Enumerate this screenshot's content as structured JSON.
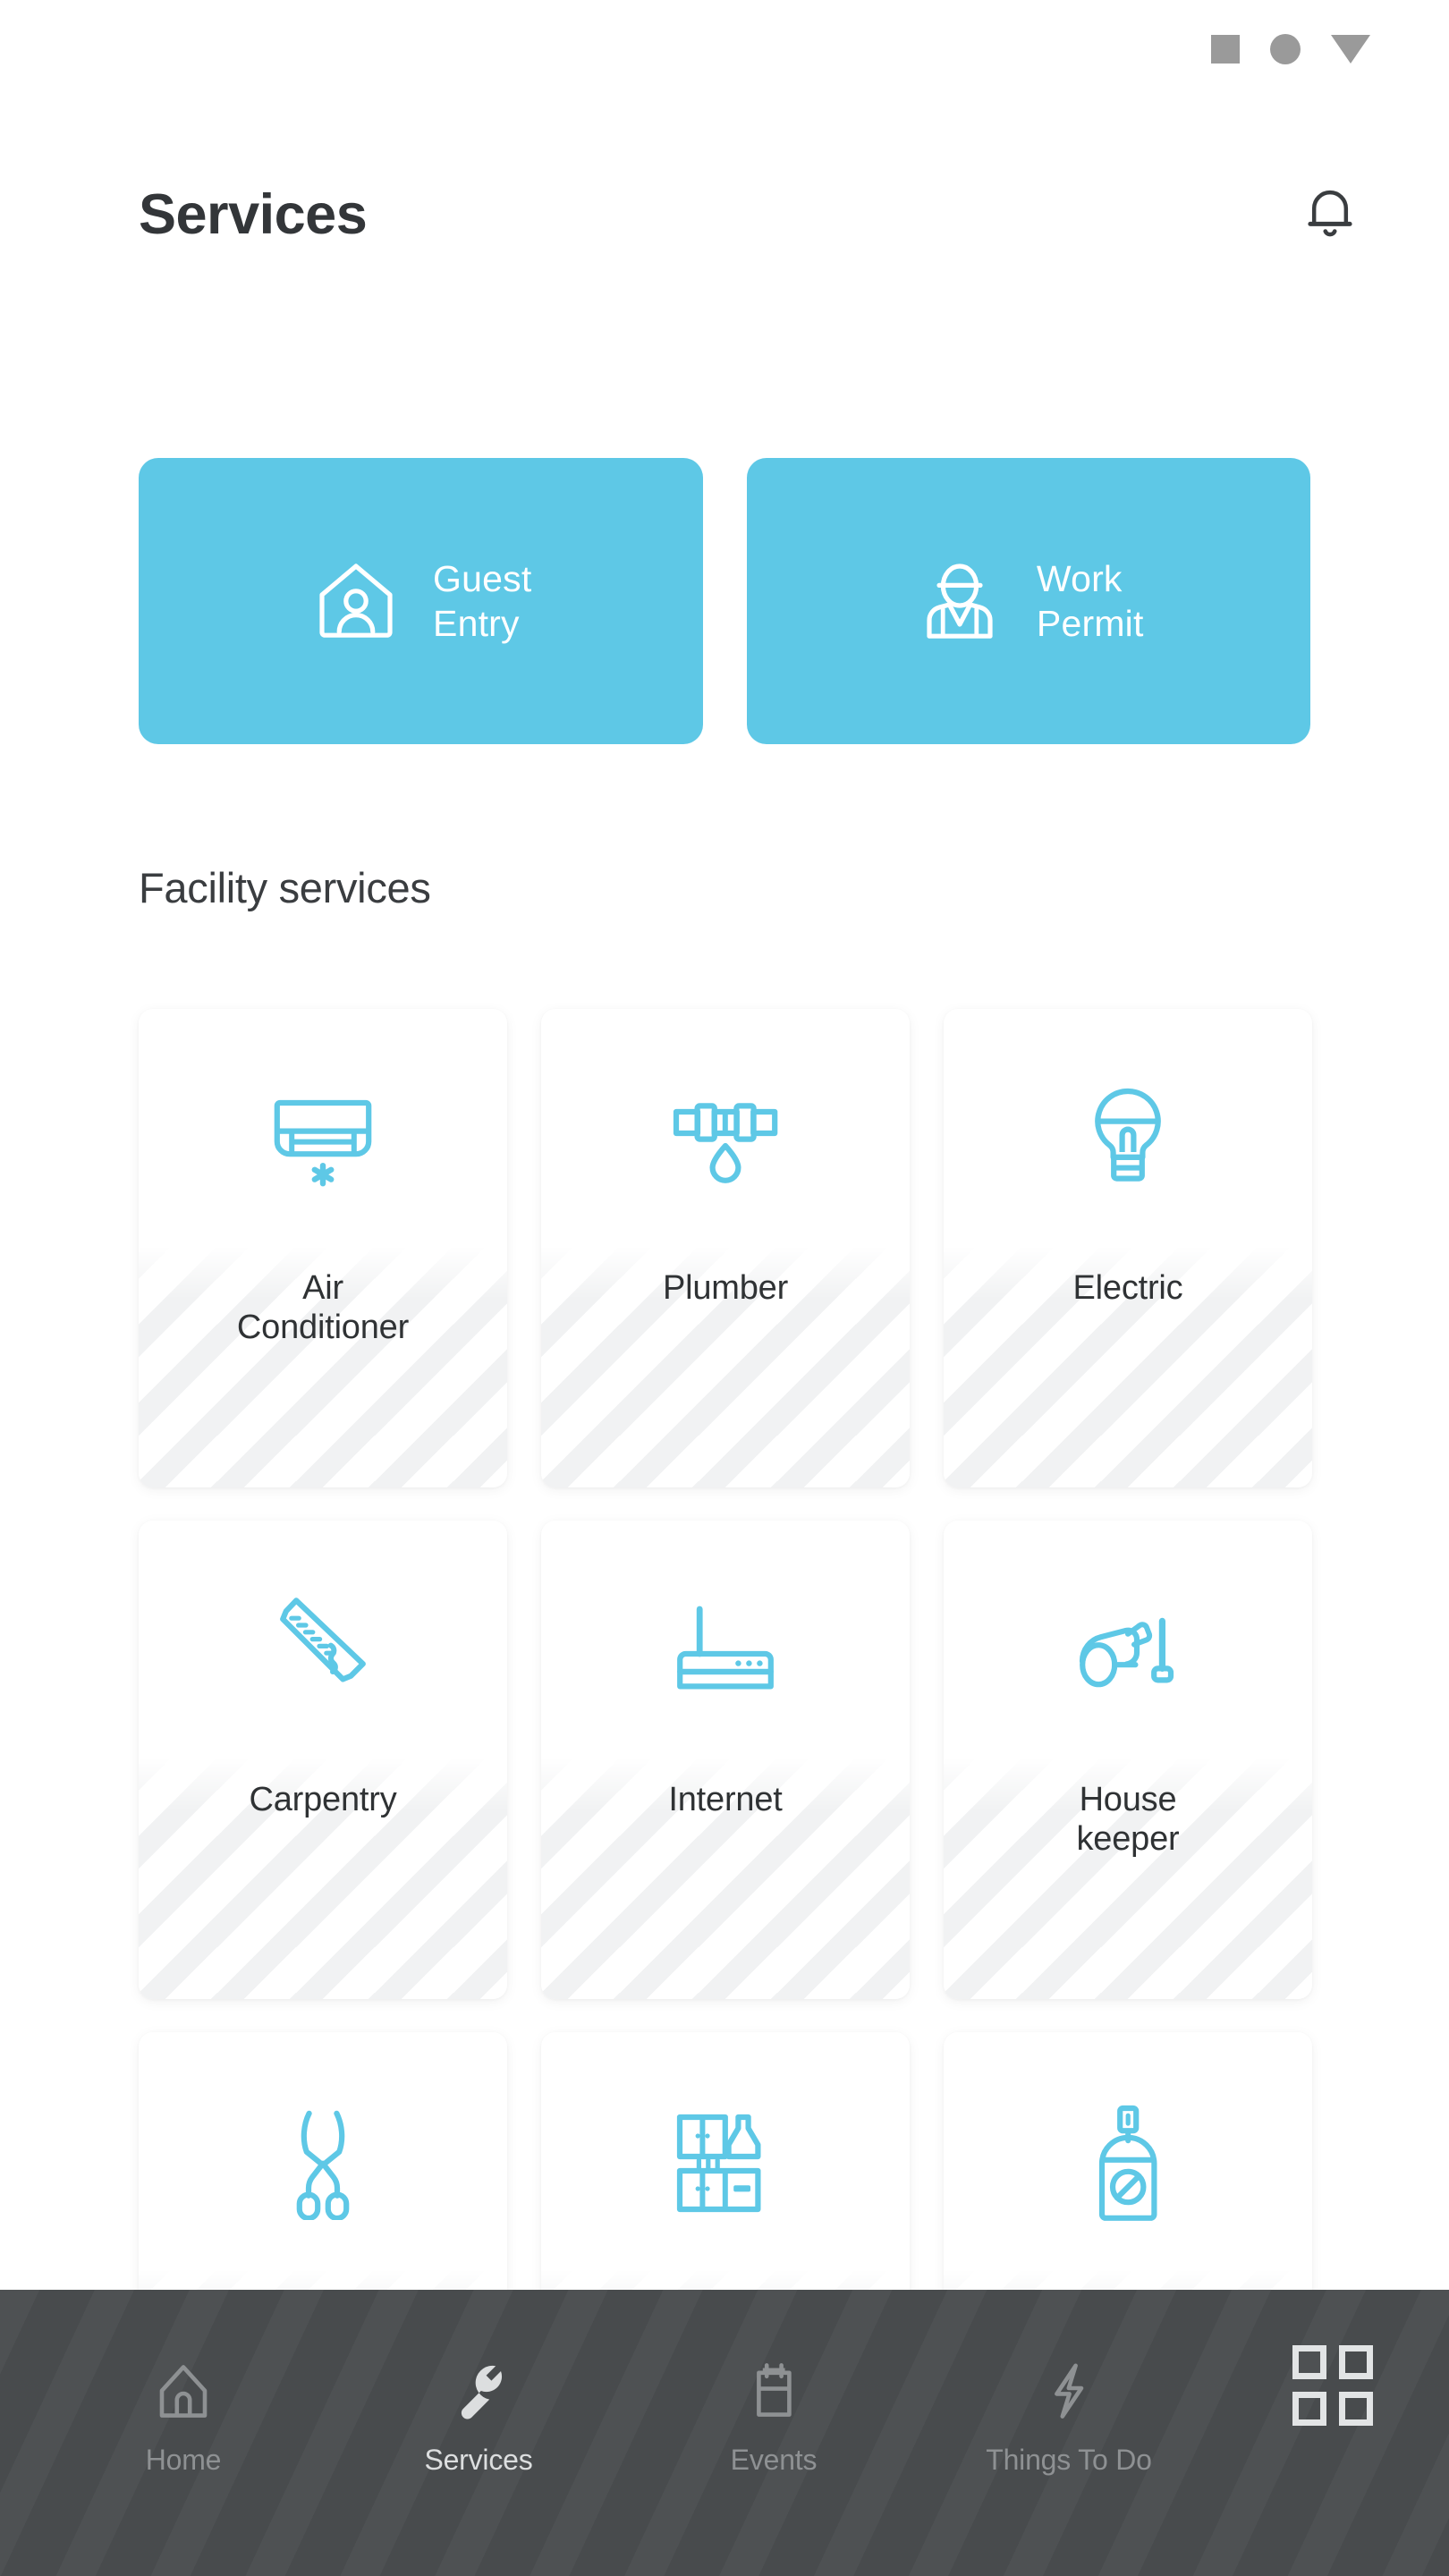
{
  "status_indicators": [
    {
      "name": "square-indicator",
      "shape": "square"
    },
    {
      "name": "circle-indicator",
      "shape": "circle"
    },
    {
      "name": "triangle-indicator",
      "shape": "triangle-down"
    }
  ],
  "header": {
    "title": "Services",
    "notification_icon": "bell-icon"
  },
  "quick_actions": [
    {
      "label": "Guest\nEntry",
      "icon": "house-person-icon",
      "color": "#5ec8e6"
    },
    {
      "label": "Work\nPermit",
      "icon": "worker-hardhat-icon",
      "color": "#5ec8e6"
    }
  ],
  "facility": {
    "section_title": "Facility services",
    "items": [
      {
        "label": "Air\nConditioner",
        "icon": "air-conditioner-icon"
      },
      {
        "label": "Plumber",
        "icon": "pipe-waterdrop-icon"
      },
      {
        "label": "Electric",
        "icon": "lightbulb-icon"
      },
      {
        "label": "Carpentry",
        "icon": "handsaw-icon"
      },
      {
        "label": "Internet",
        "icon": "router-icon"
      },
      {
        "label": "House\nkeeper",
        "icon": "vacuum-cleaner-icon"
      },
      {
        "label": "",
        "icon": "garden-shears-icon"
      },
      {
        "label": "",
        "icon": "kitchen-cabinet-icon"
      },
      {
        "label": "",
        "icon": "spray-can-icon"
      }
    ]
  },
  "bottom_nav": {
    "items": [
      {
        "label": "Home",
        "icon": "house-icon",
        "active": false
      },
      {
        "label": "Services",
        "icon": "wrench-icon",
        "active": true
      },
      {
        "label": "Events",
        "icon": "calendar-icon",
        "active": false
      },
      {
        "label": "Things To Do",
        "icon": "lightning-bolt-icon",
        "active": false
      }
    ],
    "grid_button": {
      "icon": "grid-four-squares-icon"
    }
  },
  "colors": {
    "accent": "#5ec8e6",
    "title": "#333639",
    "nav_background": "#4a4d4f",
    "nav_inactive": "#8e9193",
    "nav_active": "#dcdedf",
    "watermark": "#f1f2f3"
  }
}
